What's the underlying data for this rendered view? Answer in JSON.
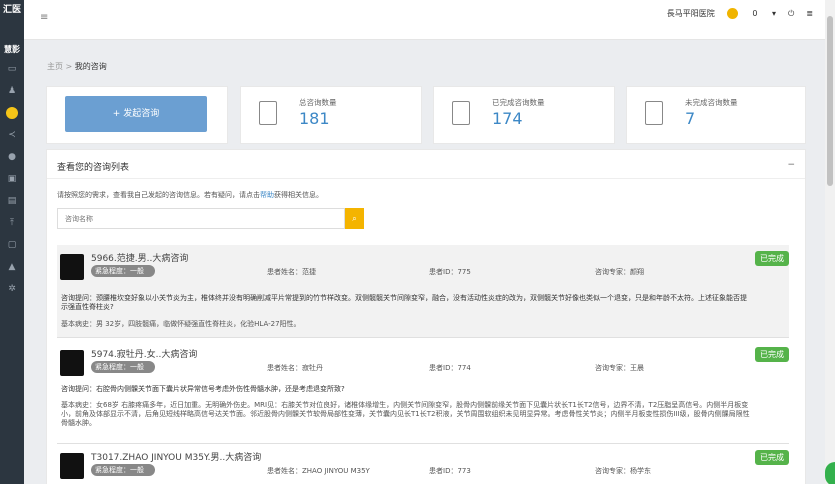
{
  "sidebar": {
    "logo": "汇医",
    "logo2": "慧影"
  },
  "topbar": {
    "hospital": "長马平阳医院",
    "coin": "0"
  },
  "breadcrumb": {
    "home": "主页",
    "sep": ">",
    "current": "我的咨询"
  },
  "start_button": "+ 发起咨询",
  "stats": [
    {
      "label": "总咨询数量",
      "value": "181"
    },
    {
      "label": "已完成咨询数量",
      "value": "174"
    },
    {
      "label": "未完成咨询数量",
      "value": "7"
    }
  ],
  "panel": {
    "title": "查看您的咨询列表",
    "collapse": "−",
    "help_prefix": "请按照您的需求，查看我自己发起的咨询信息。若有疑问，请点击",
    "help_link": "帮助",
    "help_suffix": "获得相关信息。",
    "search_placeholder": "咨询名称"
  },
  "items": [
    {
      "title": "5966.范捷.男..大病咨询",
      "urgency": "紧急程度：一般",
      "patient": "患者姓名：范捷",
      "pid": "患者ID：775",
      "expert": "咨询专家：颜翔",
      "status": "已完成",
      "question": "咨询提问：颈腰椎坎变好象以小关节炎为主，椎体终并没有明确削减平片常提到的竹节样改变。双侧髋髋关节间隙变窄，融合，没有活动性炎症的改为，双侧髋关节好像也类似一个退变，只是和年龄不太符。上述征象能否提示强直性脊柱炎?",
      "history": "基本病史：男 32岁，四肢髋痛，临做怀疑强直性脊柱炎，化验HLA-27阳性。"
    },
    {
      "title": "5974.寂牡丹.女..大病咨询",
      "urgency": "紧急程度：一般",
      "patient": "患者姓名：寂牡丹",
      "pid": "患者ID：774",
      "expert": "咨询专家：王晨",
      "status": "已完成",
      "question": "咨询提问：右腔骨内侧髁关节面下囊片状异常信号考虑外伤性骨髓水肿，还是考虑退变所致?",
      "history": "基本病史：女68岁 右膝疼痛多年，近日加重。无明确外伤史。MRI见：右膝关节对位良好，诸椎体缘增生，内侧关节间隙变窄，股骨内侧髁前缘关节面下见囊片状长T1长T2信号，边界不清，T2压脂呈高信号。内侧半月板变小，前角及体部显示不清，后角见短线样略高信号达关节面。邻近股骨内侧髁关节软骨局部性变薄，关节囊内见长T1长T2积液，关节周围软组织未见明显异常。考虑骨性关节炎；内侧半月板变性损伤III级，股骨内侧髁局限性骨髓水肿。"
    },
    {
      "title": "T3017.ZHAO JINYOU M35Y.男..大病咨询",
      "urgency": "紧急程度：一般",
      "patient": "患者姓名：ZHAO JINYOU M35Y",
      "pid": "患者ID：773",
      "expert": "咨询专家：杨学东",
      "status": "已完成"
    }
  ]
}
